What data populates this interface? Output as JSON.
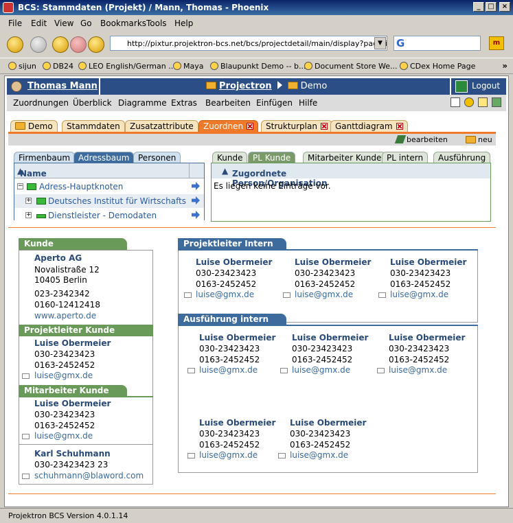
{
  "window": {
    "title": "BCS: Stammdaten (Projekt) / Mann, Thomas - Phoenix"
  },
  "menubar": [
    "File",
    "Edit",
    "View",
    "Go",
    "Bookmarks",
    "Tools",
    "Help"
  ],
  "url": "http://pixtur.projektron-bcs.net/bcs/projectdetail/main/display?pagetimest",
  "search": {
    "logo": "G"
  },
  "bookmarks": [
    "sijun",
    "DB24",
    "LEO English/German ...",
    "Maya",
    "Blaupunkt Demo -- b...",
    "Document Store We...",
    "CDex Home Page"
  ],
  "app": {
    "user": "Thomas Mann",
    "product": "Projectron",
    "project": "Demo",
    "logout": "Logout"
  },
  "appmenu": [
    "Zuordnungen",
    "Überblick",
    "Diagramme",
    "Extras",
    "Bearbeiten",
    "Einfügen",
    "Hilfe"
  ],
  "tabs": [
    "Demo",
    "Stammdaten",
    "Zusatzattribute",
    "Zuordnen",
    "Strukturplan",
    "Ganttdiagram"
  ],
  "actions": {
    "edit": "bearbeiten",
    "new": "neu"
  },
  "lefttabs": [
    "Firmenbaum",
    "Adressbaum",
    "Personen"
  ],
  "righttabs": [
    "Kunde",
    "PL Kunde",
    "Mitarbeiter Kunde",
    "PL intern",
    "Ausführung"
  ],
  "tree": {
    "header": "Name",
    "rows": [
      "Adress-Hauptknoten",
      "Deutsches Institut für Wirtschafts",
      "Dienstleister - Demodaten"
    ]
  },
  "assigned": {
    "header": "Zugordnete Person/Organisation",
    "empty": "Es liegen keine Einträge vor."
  },
  "kunde": {
    "title": "Kunde",
    "name": "Aperto AG",
    "street": "Novalistraße 12",
    "city": "10405 Berlin",
    "phone": "023-2342342",
    "mobile": "0160-12412418",
    "web": "www.aperto.de"
  },
  "pl_kunde": {
    "title": "Projektleiter Kunde",
    "name": "Luise Obermeier",
    "phone": "030-23423423",
    "mobile": "0163-2452452",
    "email": "luise@gmx.de"
  },
  "ma_kunde": {
    "title": "Mitarbeiter Kunde",
    "p1": {
      "name": "Luise Obermeier",
      "phone": "030-23423423",
      "mobile": "0163-2452452",
      "email": "luise@gmx.de"
    },
    "p2": {
      "name": "Karl Schuhmann",
      "phone": "030-23423423 23",
      "email": "schuhmann@blaword.com"
    }
  },
  "pl_intern": {
    "title": "Projektleiter Intern",
    "person": {
      "name": "Luise Obermeier",
      "phone": "030-23423423",
      "mobile": "0163-2452452",
      "email": "luise@gmx.de"
    }
  },
  "ausfuehrung": {
    "title": "Ausführung intern"
  },
  "status": "Projektron BCS Version 4.0.1.14"
}
